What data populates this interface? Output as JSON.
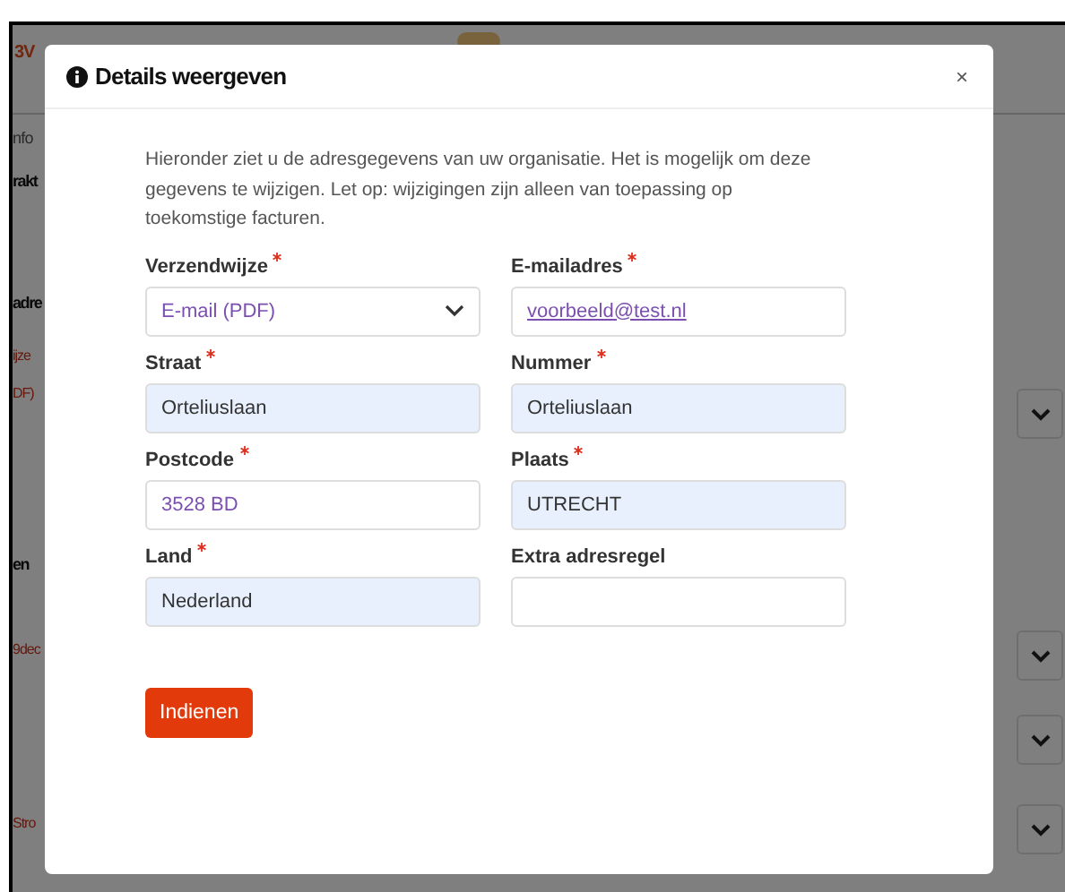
{
  "background": {
    "logo": "3V",
    "fragments": [
      {
        "text": "nfo",
        "kind": "muted"
      },
      {
        "text": "rakt",
        "kind": "heading"
      },
      {
        "text": "adre",
        "kind": "heading"
      },
      {
        "text": "ijze",
        "kind": "error"
      },
      {
        "text": "DF)",
        "kind": "error"
      },
      {
        "text": "en",
        "kind": "heading"
      },
      {
        "text": "9dec",
        "kind": "error"
      },
      {
        "text": "Stro",
        "kind": "error"
      }
    ]
  },
  "modal": {
    "title": "Details weergeven",
    "close": "×",
    "intro": "Hieronder ziet u de adresgegevens van uw organisatie. Het is mogelijk om deze gegevens te wijzigen. Let op: wijzigingen zijn alleen van toepassing op toekomstige facturen.",
    "fields": [
      {
        "label": "Verzendwijze",
        "required": true,
        "kind": "select",
        "value": "E-mail (PDF)",
        "autofilled": false
      },
      {
        "label": "E-mailadres",
        "required": true,
        "kind": "link",
        "value": "voorbeeld@test.nl",
        "autofilled": false
      },
      {
        "label": "Straat",
        "required": true,
        "kind": "text",
        "value": "Orteliuslaan",
        "autofilled": true
      },
      {
        "label": "Nummer",
        "required": true,
        "kind": "text",
        "value": "Orteliuslaan",
        "autofilled": true
      },
      {
        "label": "Postcode",
        "required": true,
        "kind": "text",
        "value": "3528 BD",
        "autofilled": false
      },
      {
        "label": "Plaats",
        "required": true,
        "kind": "text",
        "value": "UTRECHT",
        "autofilled": true
      },
      {
        "label": "Land",
        "required": true,
        "kind": "text",
        "value": "Nederland",
        "autofilled": true
      },
      {
        "label": "Extra adresregel",
        "required": false,
        "kind": "text",
        "autofilled": false
      }
    ],
    "submit": "Indienen"
  }
}
